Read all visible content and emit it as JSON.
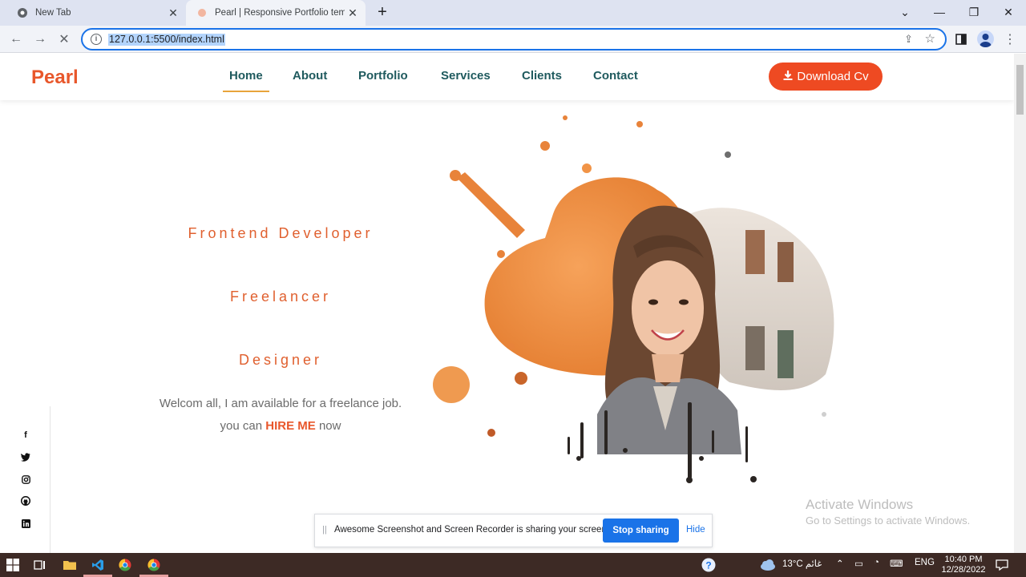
{
  "browser": {
    "tabs": [
      {
        "title": "New Tab",
        "active": false
      },
      {
        "title": "Pearl | Responsive Portfolio temp",
        "active": true
      }
    ],
    "address": "127.0.0.1:5500/index.html"
  },
  "site": {
    "logo": "Pearl",
    "nav": [
      "Home",
      "About",
      "Portfolio",
      "Services",
      "Clients",
      "Contact"
    ],
    "active_nav": "Home",
    "cv_button": "Download Cv",
    "roles": [
      "Frontend Developer",
      "Freelancer",
      "Designer"
    ],
    "welcome": "Welcom all, I am available for a freelance job.",
    "hire_prefix": "you can",
    "hire_emphasis": "HIRE ME",
    "hire_suffix": "now",
    "social_icons": [
      "facebook-icon",
      "twitter-icon",
      "instagram-icon",
      "github-icon",
      "linkedin-icon"
    ],
    "accent_color": "#e8572b",
    "nav_color": "#1f5a5e"
  },
  "share_bar": {
    "message": "Awesome Screenshot and Screen Recorder is sharing your screen.",
    "stop_label": "Stop sharing",
    "hide_label": "Hide"
  },
  "watermark": {
    "title": "Activate Windows",
    "subtitle": "Go to Settings to activate Windows."
  },
  "taskbar": {
    "weather": "13°C غائم",
    "language": "ENG",
    "time": "10:40 PM",
    "date": "12/28/2022"
  }
}
